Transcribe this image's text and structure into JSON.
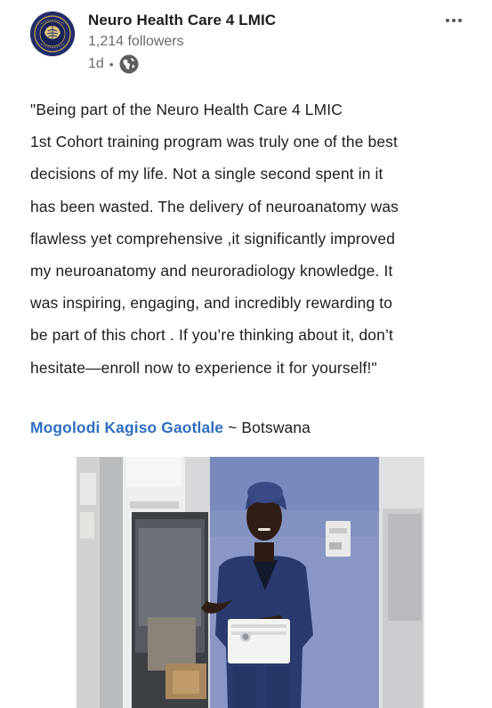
{
  "post": {
    "company_name": "Neuro Health Care 4 LMIC",
    "followers": "1,214 followers",
    "time_ago": "1d",
    "dot": "•",
    "icons": {
      "visibility": "globe-icon",
      "menu": "more-horizontal-icon",
      "avatar": "company-logo"
    },
    "body_lines": [
      "\"Being part of the Neuro Health Care 4 LMIC",
      "1st Cohort training program was truly one of the best",
      "decisions of my life. Not a single second spent in it",
      "has been wasted. The delivery of neuroanatomy was",
      "flawless yet comprehensive ,it significantly improved",
      "my neuroanatomy and neuroradiology knowledge. It",
      "was inspiring, engaging, and incredibly rewarding to",
      "be part of this chort . If you’re thinking about it, don’t",
      "hesitate—enroll now to experience it for yourself!\""
    ],
    "author": {
      "name": "Mogolodi Kagiso Gaotlale",
      "separator": " ~ ",
      "country": "Botswana"
    },
    "colors": {
      "link": "#2e6fc1",
      "text": "#1d1d1d",
      "muted": "#6b6b6b",
      "logo_bg": "#232b6b"
    }
  }
}
